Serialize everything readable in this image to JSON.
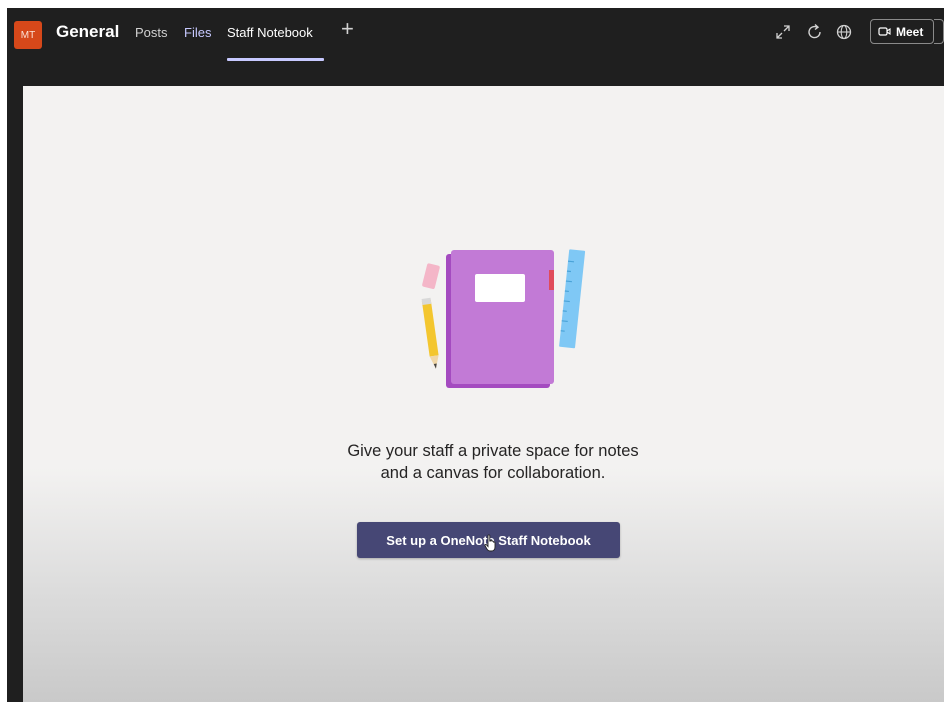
{
  "header": {
    "avatar_initials": "MT",
    "channel_title": "General",
    "tabs": [
      {
        "label": "Posts"
      },
      {
        "label": "Files"
      },
      {
        "label": "Staff Notebook",
        "active": true
      }
    ],
    "add_tab_symbol": "+",
    "icons": [
      "expand-icon",
      "refresh-icon",
      "globe-icon"
    ],
    "meet_label": "Meet"
  },
  "main": {
    "message_line1": "Give your staff a private space for notes",
    "message_line2": "and a canvas for collaboration.",
    "setup_button_label": "Set up a OneNote Staff Notebook"
  },
  "colors": {
    "avatar_bg": "#d6481a",
    "accent": "#c7c9ff",
    "button_bg": "#464775",
    "notebook": "#c27ad6"
  }
}
